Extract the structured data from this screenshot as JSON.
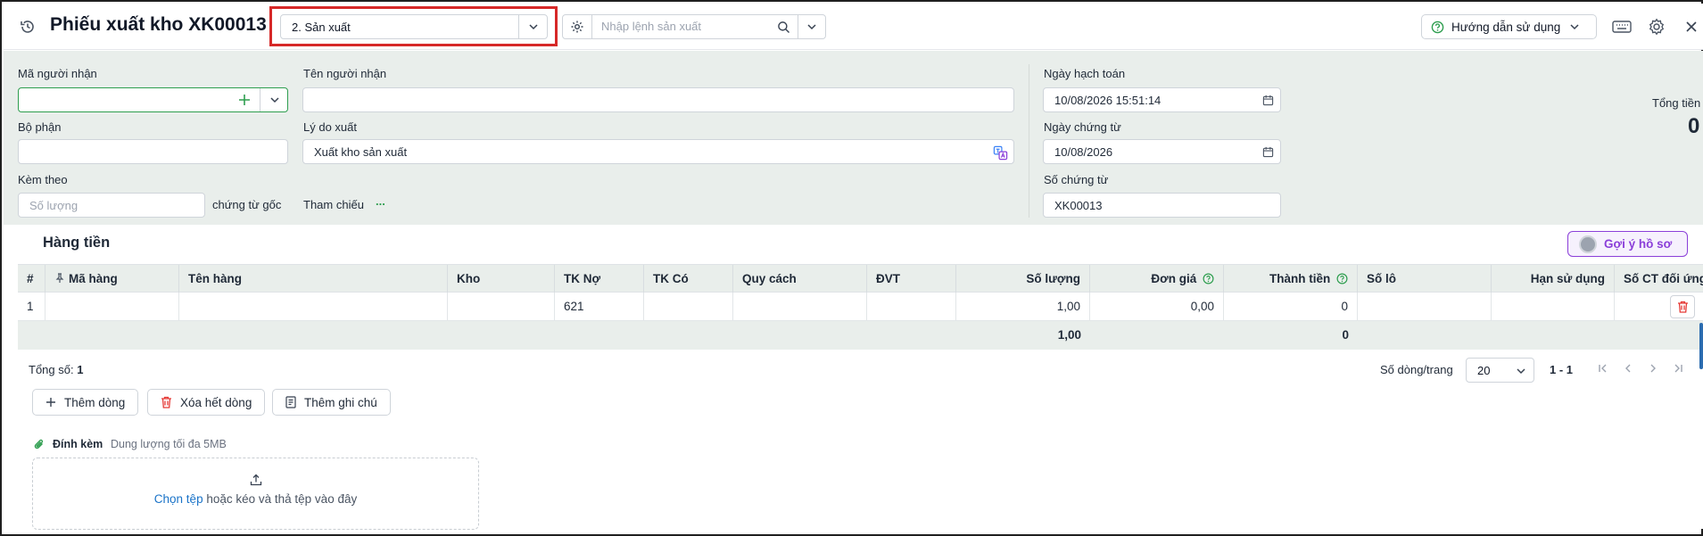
{
  "header": {
    "title": "Phiếu xuất kho XK00013",
    "type_select_value": "2. Sản xuất",
    "search_placeholder": "Nhập lệnh sản xuất",
    "help_label": "Hướng dẫn sử dụng"
  },
  "form": {
    "receiver_code_label": "Mã người nhận",
    "receiver_code_value": "",
    "receiver_name_label": "Tên người nhận",
    "receiver_name_value": "",
    "department_label": "Bộ phận",
    "department_value": "",
    "reason_label": "Lý do xuất",
    "reason_value": "Xuất kho sản xuất",
    "attach_label": "Kèm theo",
    "quantity_placeholder": "Số lượng",
    "original_docs_label": "chứng từ gốc",
    "reference_label": "Tham chiếu",
    "reference_link": "...",
    "posting_date_label": "Ngày hạch toán",
    "posting_date_value": "10/08/2026 15:51:14",
    "doc_date_label": "Ngày chứng từ",
    "doc_date_value": "10/08/2026",
    "doc_no_label": "Số chứng từ",
    "doc_no_value": "XK00013",
    "total_label": "Tổng tiền",
    "total_value": "0"
  },
  "grid": {
    "section_title": "Hàng tiền",
    "suggest_label": "Gợi ý hồ sơ",
    "columns": [
      "#",
      "Mã hàng",
      "Tên hàng",
      "Kho",
      "TK Nợ",
      "TK Có",
      "Quy cách",
      "ĐVT",
      "Số lượng",
      "Đơn giá",
      "Thành tiền",
      "Số lô",
      "Hạn sử dụng",
      "Số CT đối ứng"
    ],
    "rows": [
      {
        "no": "1",
        "item_code": "",
        "item_name": "",
        "warehouse": "",
        "debit_account": "621",
        "credit_account": "",
        "spec": "",
        "unit": "",
        "quantity": "1,00",
        "unit_price": "0,00",
        "amount": "0",
        "lot": "",
        "expiry": "",
        "ref_doc": ""
      }
    ],
    "footer": {
      "quantity_total": "1,00",
      "amount_total": "0"
    }
  },
  "pager": {
    "total_label": "Tổng số:",
    "total_value": "1",
    "rows_per_page_label": "Số dòng/trang",
    "rows_per_page_value": "20",
    "range": "1 - 1"
  },
  "actions": {
    "add_row": "Thêm dòng",
    "delete_all": "Xóa hết dòng",
    "add_note": "Thêm ghi chú"
  },
  "attachment": {
    "label": "Đính kèm",
    "limit": "Dung lượng tối đa 5MB",
    "choose_file": "Chọn tệp",
    "drag_text": "hoặc kéo và thả tệp vào đây"
  },
  "colors": {
    "accent_green": "#2e9e4f",
    "highlight_red": "#d62828",
    "form_bg": "#e9eeeb",
    "link_blue": "#1a73c8",
    "suggest_purple": "#8b3fd9",
    "delete_red": "#e53935"
  }
}
